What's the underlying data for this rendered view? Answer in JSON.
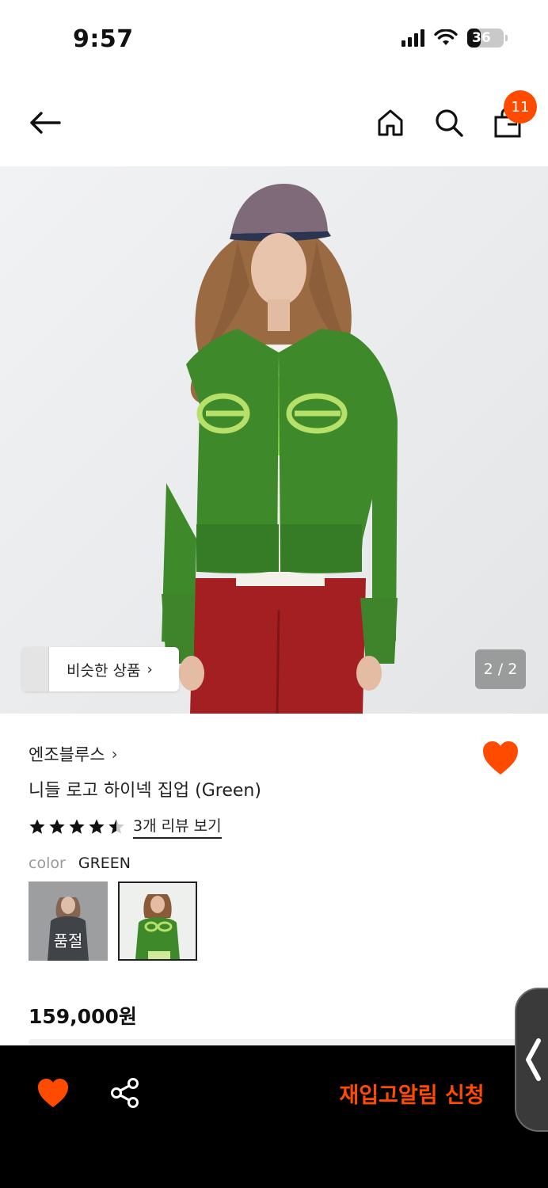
{
  "status": {
    "time": "9:57",
    "battery": "36"
  },
  "nav": {
    "cart_count": "11"
  },
  "gallery": {
    "similar_label": "비슷한 상품",
    "counter": "2 / 2"
  },
  "product": {
    "brand": "엔조블루스",
    "name": "니들 로고 하이넥 집업 (Green)",
    "rating": 4.5,
    "review_link": "3개 리뷰 보기",
    "color_label": "color",
    "color_value": "GREEN",
    "swatches": [
      {
        "name": "black",
        "soldout_label": "품절"
      },
      {
        "name": "green"
      }
    ],
    "price": "159,000원"
  },
  "bottom_bar": {
    "restock_label": "재입고알림 신청"
  },
  "colors": {
    "accent": "#ff4b00",
    "bottom_bar": "#000000"
  }
}
